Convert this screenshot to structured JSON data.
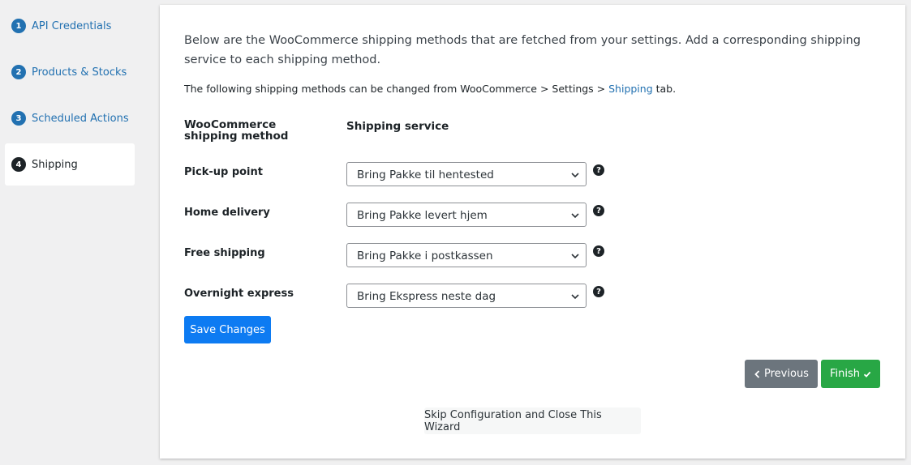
{
  "steps": [
    {
      "number": "1",
      "label": "API Credentials"
    },
    {
      "number": "2",
      "label": "Products & Stocks"
    },
    {
      "number": "3",
      "label": "Scheduled Actions"
    },
    {
      "number": "4",
      "label": "Shipping"
    }
  ],
  "intro": "Below are the WooCommerce shipping methods that are fetched from your settings. Add a corresponding shipping service to each shipping method.",
  "note": {
    "prefix": "The following shipping methods can be changed from WooCommerce > Settings > ",
    "link": "Shipping",
    "suffix": " tab."
  },
  "columns": {
    "method": "WooCommerce shipping method",
    "service": "Shipping service"
  },
  "rows": [
    {
      "method": "Pick-up point",
      "service": "Bring Pakke til hentested"
    },
    {
      "method": "Home delivery",
      "service": "Bring Pakke levert hjem"
    },
    {
      "method": "Free shipping",
      "service": "Bring Pakke i postkassen"
    },
    {
      "method": "Overnight express",
      "service": "Bring Ekspress neste dag"
    }
  ],
  "help_glyph": "?",
  "buttons": {
    "save": "Save Changes",
    "previous": "Previous",
    "finish": "Finish",
    "skip": "Skip Configuration and Close This Wizard"
  },
  "icons": {
    "select_arrow": "chevron-down-icon",
    "previous": "chevron-left-icon",
    "finish": "check-icon",
    "help": "question-circle-icon"
  },
  "colors": {
    "link": "#2271b1",
    "save_button": "#0d7bf2",
    "previous_button": "#6c757d",
    "finish_button": "#28a745"
  }
}
